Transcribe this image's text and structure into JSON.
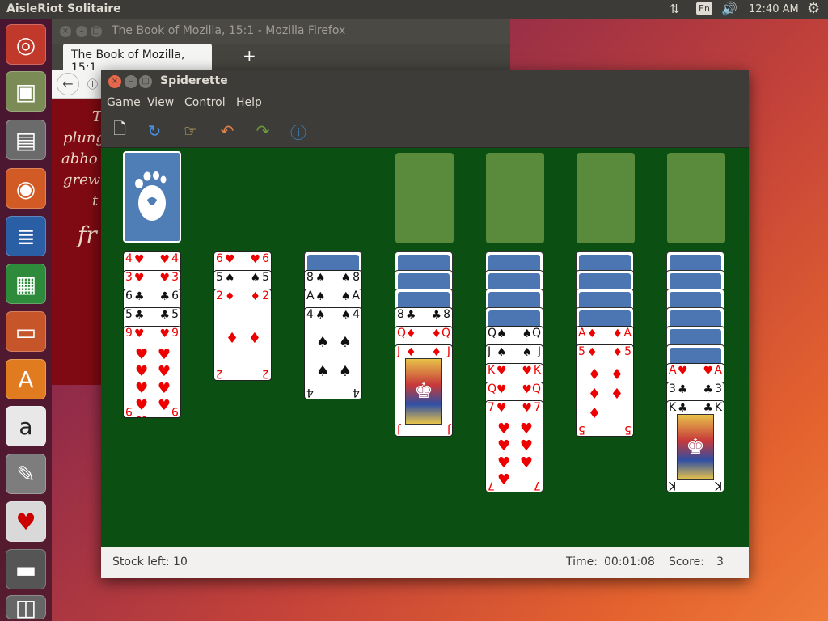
{
  "top_panel": {
    "app_title": "AisleRiot Solitaire",
    "lang": "En",
    "clock": "12:40 AM"
  },
  "launcher": {
    "items": [
      "ubuntu-dash",
      "software-updater",
      "files",
      "firefox",
      "libreoffice-writer",
      "libreoffice-calc",
      "libreoffice-impress",
      "ubuntu-software",
      "amazon",
      "system-settings",
      "aisleriot-solitaire",
      "save",
      "trash"
    ]
  },
  "firefox": {
    "window_title": "The Book of Mozilla, 15:1 - Mozilla Firefox",
    "tab_title": "The Book of Mozilla, 15:1",
    "text_fragments": [
      "T",
      "plung",
      "abho",
      "grew",
      "t",
      "fr"
    ]
  },
  "spiderette": {
    "window_title": "Spiderette",
    "menu": [
      "Game",
      "View",
      "Control",
      "Help"
    ],
    "toolbar": [
      "new-game-icon",
      "restart-icon",
      "hint-icon",
      "undo-icon",
      "redo-icon",
      "info-icon"
    ],
    "status": {
      "stock": "Stock left: 10",
      "time_label": "Time:",
      "time_value": "00:01:08",
      "score_label": "Score:",
      "score_value": "3"
    },
    "columns": [
      {
        "cards": [
          {
            "rank": "4",
            "suit": "♥",
            "color": "red"
          },
          {
            "rank": "3",
            "suit": "♥",
            "color": "red"
          },
          {
            "rank": "6",
            "suit": "♣",
            "color": "black"
          },
          {
            "rank": "5",
            "suit": "♣",
            "color": "black"
          },
          {
            "rank": "9",
            "suit": "♥",
            "color": "red"
          }
        ]
      },
      {
        "cards": [
          {
            "rank": "6",
            "suit": "♥",
            "color": "red"
          },
          {
            "rank": "5",
            "suit": "♠",
            "color": "black"
          },
          {
            "rank": "2",
            "suit": "♦",
            "color": "red"
          }
        ]
      },
      {
        "backs": 1,
        "cards": [
          {
            "rank": "8",
            "suit": "♠",
            "color": "black"
          },
          {
            "rank": "A",
            "suit": "♠",
            "color": "black"
          },
          {
            "rank": "4",
            "suit": "♠",
            "color": "black"
          }
        ]
      },
      {
        "backs": 3,
        "cards": [
          {
            "rank": "8",
            "suit": "♣",
            "color": "black"
          },
          {
            "rank": "Q",
            "suit": "♦",
            "color": "red"
          },
          {
            "rank": "J",
            "suit": "♦",
            "color": "red"
          }
        ]
      },
      {
        "backs": 4,
        "cards": [
          {
            "rank": "Q",
            "suit": "♠",
            "color": "black"
          },
          {
            "rank": "J",
            "suit": "♠",
            "color": "black"
          },
          {
            "rank": "K",
            "suit": "♥",
            "color": "red"
          },
          {
            "rank": "Q",
            "suit": "♥",
            "color": "red"
          },
          {
            "rank": "7",
            "suit": "♥",
            "color": "red"
          }
        ]
      },
      {
        "backs": 4,
        "cards": [
          {
            "rank": "A",
            "suit": "♦",
            "color": "red"
          },
          {
            "rank": "5",
            "suit": "♦",
            "color": "red"
          }
        ]
      },
      {
        "backs": 6,
        "cards": [
          {
            "rank": "A",
            "suit": "♥",
            "color": "red"
          },
          {
            "rank": "3",
            "suit": "♣",
            "color": "black"
          },
          {
            "rank": "K",
            "suit": "♣",
            "color": "black"
          }
        ]
      }
    ]
  }
}
